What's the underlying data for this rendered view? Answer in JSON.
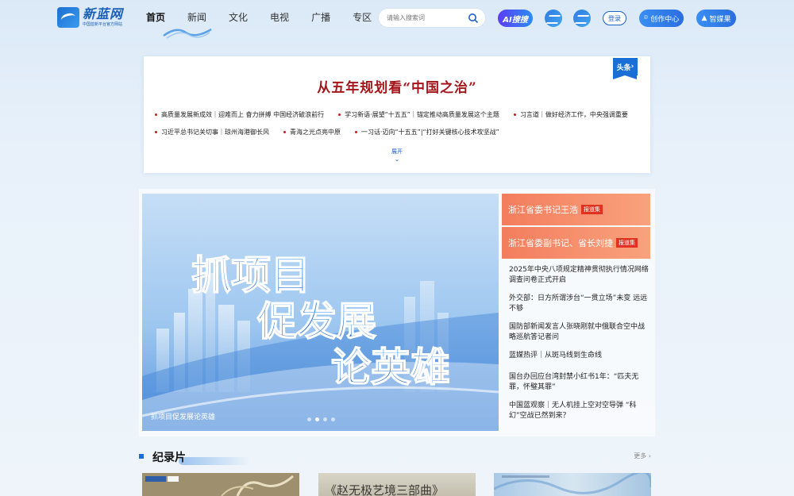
{
  "header": {
    "logo_title": "新蓝网",
    "logo_sub": "中国蓝新平台官方网站",
    "nav": [
      "首页",
      "新闻",
      "文化",
      "电视",
      "广播",
      "专区"
    ],
    "search_placeholder": "请输入搜索词",
    "ai_label": "AI搜搜",
    "login_label": "登录",
    "create_label": "创作中心",
    "smart_label": "智媒果"
  },
  "headline": {
    "badge": "头条",
    "title": "从五年规划看“中国之治”",
    "row1": [
      "高质量发展新成效｜迎难而上 奋力拼搏 中国经济破浪前行",
      "学习新语·展望“十五五”｜锚定推动高质量发展这个主题",
      "习言道｜做好经济工作，中央强调重要"
    ],
    "row2": [
      "习近平总书记关切事｜琼州海港御长风",
      "青海之光点亮中原",
      "一习话·迈向“十五五”|“打好关键核心技术攻坚战”"
    ],
    "expand": "展开"
  },
  "feature": {
    "banner_text_lines": [
      "抓项目",
      "促发展",
      "论英雄"
    ],
    "caption": "抓项目促发展论英雄",
    "side_cards": [
      {
        "text": "浙江省委书记王浩",
        "tag": "报道集"
      },
      {
        "text": "浙江省委副书记、省长刘捷",
        "tag": "报道集"
      }
    ],
    "side_list": [
      "2025年中央八项规定精神贯彻执行情况网络调查问卷正式开启",
      "外交部：日方所谓涉台“一贯立场”未变 远远不够",
      "国防部新闻发言人张晓刚就中俄联合空中战略巡航答记者问",
      "蓝媒热评｜从斑马线到生命线",
      "国台办回应台湾封禁小红书1年：“匹夫无罪，怀璧其罪”",
      "中国蓝观察｜无人机挂上空对空导弹 “科幻”空战已然到来？"
    ]
  },
  "documentary": {
    "title": "纪录片",
    "more": "更多",
    "thumb2_text": "《赵无极艺境三部曲》"
  },
  "colors": {
    "brand_blue": "#1a6fd6",
    "headline_red": "#a5161b",
    "side_card": "#f37d5d"
  }
}
